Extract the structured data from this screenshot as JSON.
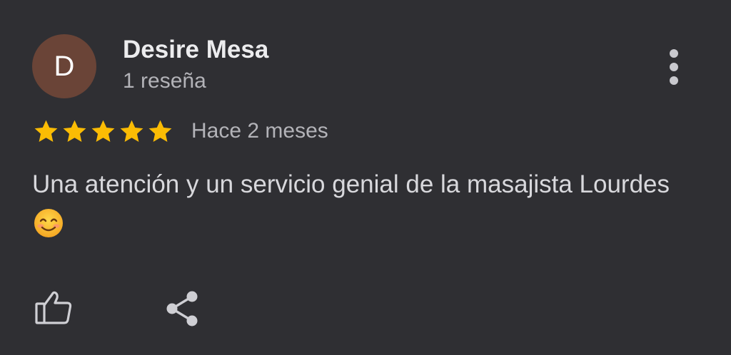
{
  "review": {
    "avatar_initial": "D",
    "author_name": "Desire Mesa",
    "author_review_count": "1 reseña",
    "rating": 5,
    "rating_max": 5,
    "time_ago": "Hace 2 meses",
    "text": "Una atención y un servicio genial de la masajista Lourdes",
    "text_emoji": "smiling-face-emoji"
  },
  "icons": {
    "more": "more-vertical-icon",
    "like": "thumbs-up-icon",
    "share": "share-icon",
    "star": "star-icon"
  },
  "colors": {
    "background": "#2f2f33",
    "avatar_bg": "#6a4437",
    "star": "#fbbc04",
    "primary_text": "#ececee",
    "secondary_text": "#b3b3b8"
  }
}
